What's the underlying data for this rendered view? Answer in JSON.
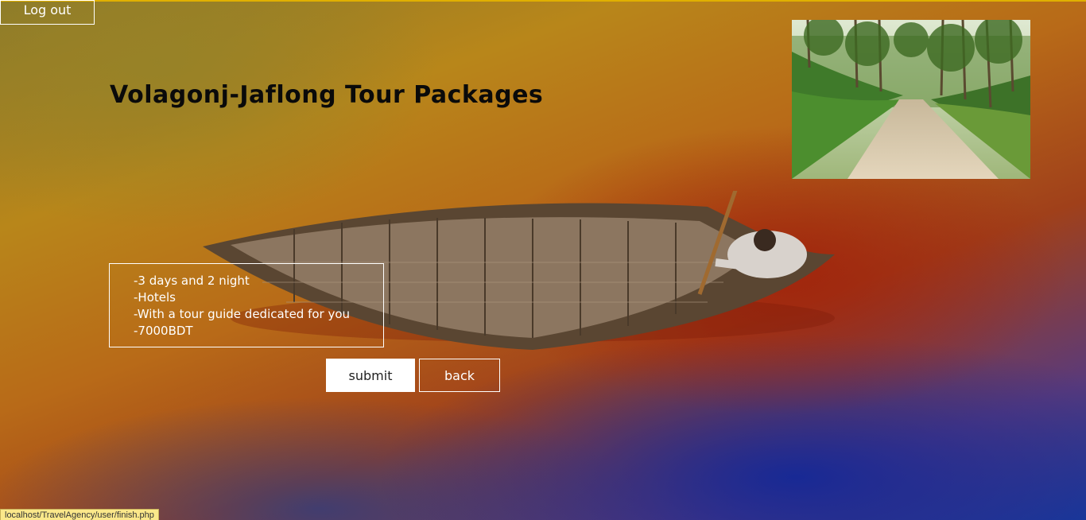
{
  "header": {
    "logout_label": "Log out"
  },
  "main": {
    "title": "Volagonj-Jaflong Tour Packages",
    "details": [
      "-3 days and 2 night",
      "-Hotels",
      "-With a tour guide dedicated for you",
      "-7000BDT"
    ],
    "submit_label": "submit",
    "back_label": "back"
  },
  "status_bar": {
    "url": "localhost/TravelAgency/user/finish.php"
  },
  "colors": {
    "accent_line": "#e0b000",
    "title_text": "#0a0a0a",
    "button_border": "#ffffff",
    "status_bar_bg": "#fbe88a"
  },
  "icons": [
    "boat-image",
    "tea-garden-photo"
  ]
}
